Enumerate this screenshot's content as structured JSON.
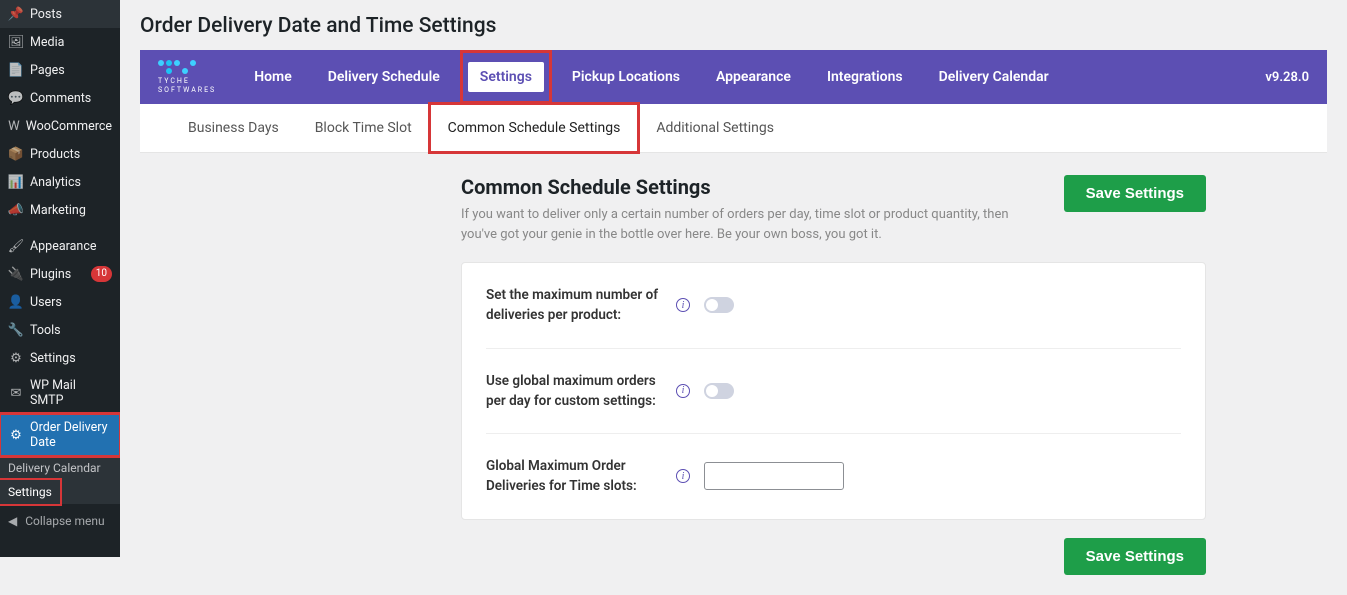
{
  "page": {
    "title": "Order Delivery Date and Time Settings",
    "version": "v9.28.0"
  },
  "sidebar": {
    "items": [
      {
        "icon": "📌",
        "label": "Posts"
      },
      {
        "icon": "🖼",
        "label": "Media"
      },
      {
        "icon": "📄",
        "label": "Pages"
      },
      {
        "icon": "💬",
        "label": "Comments"
      },
      {
        "icon": "W",
        "label": "WooCommerce"
      },
      {
        "icon": "📦",
        "label": "Products"
      },
      {
        "icon": "📊",
        "label": "Analytics"
      },
      {
        "icon": "📣",
        "label": "Marketing"
      },
      {
        "icon": "🖌",
        "label": "Appearance"
      },
      {
        "icon": "🔌",
        "label": "Plugins",
        "badge": "10"
      },
      {
        "icon": "👤",
        "label": "Users"
      },
      {
        "icon": "🔧",
        "label": "Tools"
      },
      {
        "icon": "⚙",
        "label": "Settings"
      },
      {
        "icon": "✉",
        "label": "WP Mail SMTP"
      },
      {
        "icon": "⚙",
        "label": "Order Delivery Date",
        "active": true
      }
    ],
    "submenu": [
      {
        "label": "Delivery Calendar"
      },
      {
        "label": "Settings",
        "highlighted": true
      }
    ],
    "collapse": "Collapse menu"
  },
  "topNav": {
    "brand": "TYCHE",
    "brandSub": "SOFTWARES",
    "items": [
      {
        "label": "Home"
      },
      {
        "label": "Delivery Schedule"
      },
      {
        "label": "Settings",
        "active": true
      },
      {
        "label": "Pickup Locations"
      },
      {
        "label": "Appearance"
      },
      {
        "label": "Integrations"
      },
      {
        "label": "Delivery Calendar"
      }
    ]
  },
  "subNav": {
    "items": [
      {
        "label": "Business Days"
      },
      {
        "label": "Block Time Slot"
      },
      {
        "label": "Common Schedule Settings",
        "active": true
      },
      {
        "label": "Additional Settings"
      }
    ]
  },
  "section": {
    "title": "Common Schedule Settings",
    "description": "If you want to deliver only a certain number of orders per day, time slot or product quantity, then you've got your genie in the bottle over here. Be your own boss, you got it."
  },
  "settings": {
    "row1": {
      "label": "Set the maximum number of deliveries per product:",
      "toggle": false
    },
    "row2": {
      "label": "Use global maximum orders per day for custom settings:",
      "toggle": false
    },
    "row3": {
      "label": "Global Maximum Order Deliveries for Time slots:",
      "value": ""
    }
  },
  "buttons": {
    "save": "Save Settings"
  }
}
